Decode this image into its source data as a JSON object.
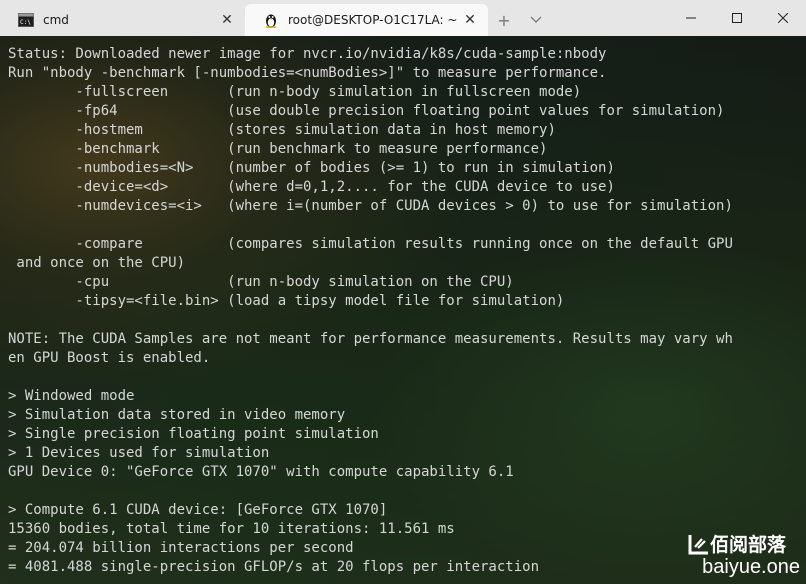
{
  "tabs": [
    {
      "title": "cmd",
      "icon": "cmd-icon",
      "active": false
    },
    {
      "title": "root@DESKTOP-O1C17LA: ~",
      "icon": "linux-penguin-icon",
      "active": true
    }
  ],
  "tab_controls": {
    "new_tab": "+",
    "dropdown": "⌵",
    "close": "✕"
  },
  "window_controls": {
    "minimize": "minimize-icon",
    "maximize": "maximize-icon",
    "close": "close-icon"
  },
  "terminal": {
    "lines": [
      "Status: Downloaded newer image for nvcr.io/nvidia/k8s/cuda-sample:nbody",
      "Run \"nbody -benchmark [-numbodies=<numBodies>]\" to measure performance.",
      "        -fullscreen       (run n-body simulation in fullscreen mode)",
      "        -fp64             (use double precision floating point values for simulation)",
      "        -hostmem          (stores simulation data in host memory)",
      "        -benchmark        (run benchmark to measure performance)",
      "        -numbodies=<N>    (number of bodies (>= 1) to run in simulation)",
      "        -device=<d>       (where d=0,1,2.... for the CUDA device to use)",
      "        -numdevices=<i>   (where i=(number of CUDA devices > 0) to use for simulation)",
      "",
      "        -compare          (compares simulation results running once on the default GPU",
      " and once on the CPU)",
      "        -cpu              (run n-body simulation on the CPU)",
      "        -tipsy=<file.bin> (load a tipsy model file for simulation)",
      "",
      "NOTE: The CUDA Samples are not meant for performance measurements. Results may vary wh",
      "en GPU Boost is enabled.",
      "",
      "> Windowed mode",
      "> Simulation data stored in video memory",
      "> Single precision floating point simulation",
      "> 1 Devices used for simulation",
      "GPU Device 0: \"GeForce GTX 1070\" with compute capability 6.1",
      "",
      "> Compute 6.1 CUDA device: [GeForce GTX 1070]",
      "15360 bodies, total time for 10 iterations: 11.561 ms",
      "= 204.074 billion interactions per second",
      "= 4081.488 single-precision GFLOP/s at 20 flops per interaction"
    ]
  },
  "watermark": {
    "top": "佰阅部落",
    "bottom": "baiyue.one"
  }
}
